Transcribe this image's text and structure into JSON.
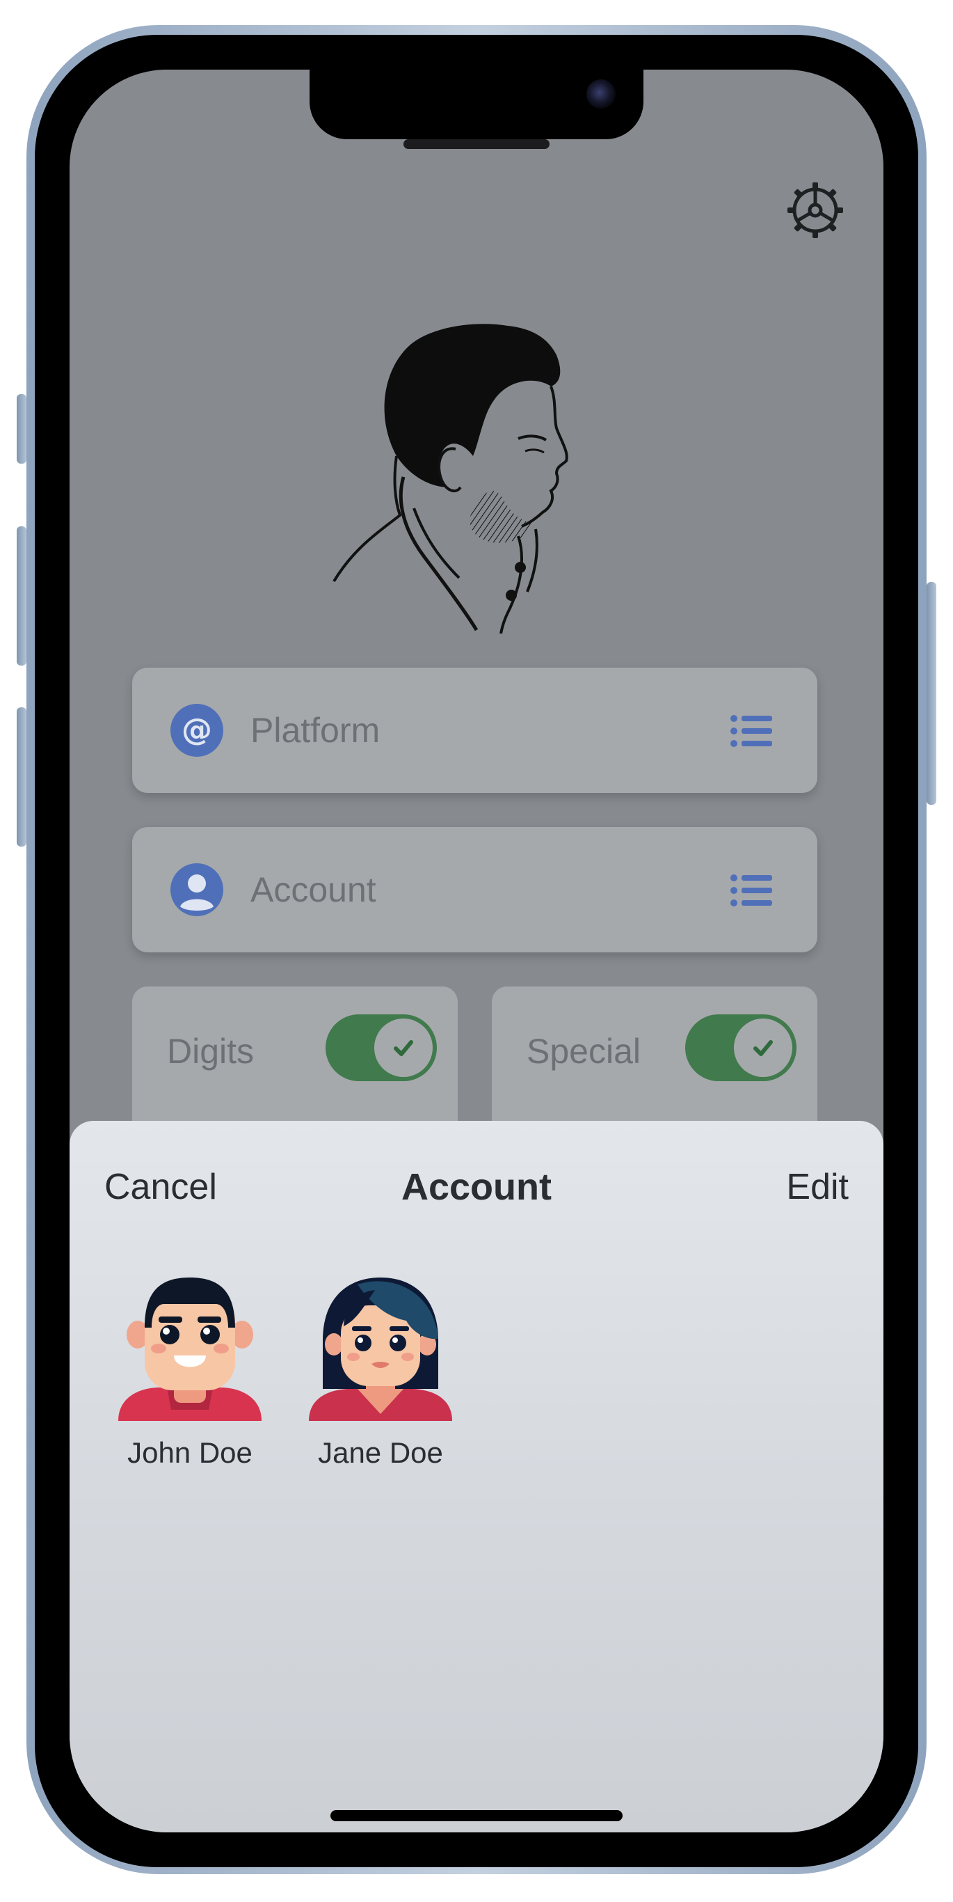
{
  "form": {
    "platform_placeholder": "Platform",
    "account_placeholder": "Account",
    "digits_label": "Digits",
    "digits_enabled": true,
    "special_label": "Special",
    "special_enabled": true
  },
  "sheet": {
    "cancel_label": "Cancel",
    "title": "Account",
    "edit_label": "Edit",
    "accounts": [
      {
        "name": "John Doe",
        "avatar": "male-avatar-icon"
      },
      {
        "name": "Jane Doe",
        "avatar": "female-avatar-icon"
      }
    ]
  },
  "colors": {
    "accent_blue": "#4f6fb8",
    "toggle_green": "#407a4d",
    "overlay_dim": "#878b8f"
  }
}
